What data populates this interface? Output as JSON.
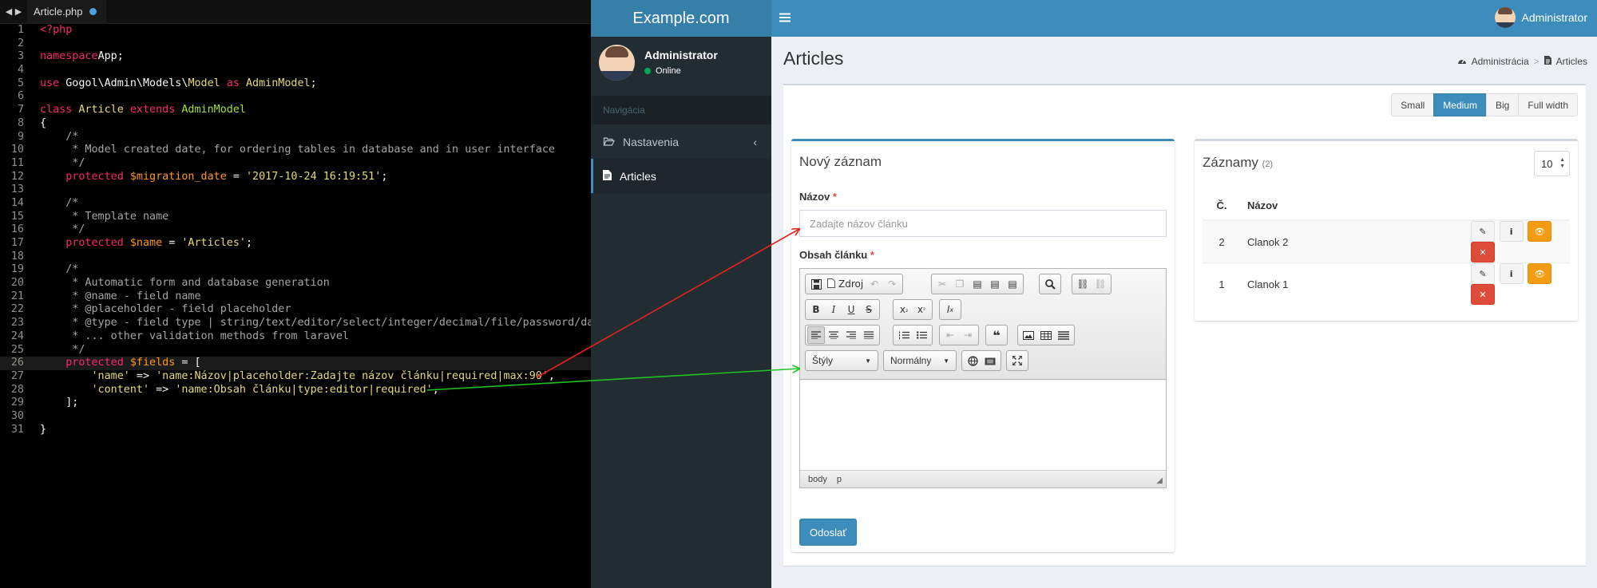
{
  "editor": {
    "tab_filename": "Article.php",
    "nav_arrows": "◀ ▶",
    "lines": [
      {
        "n": "1",
        "t": [
          [
            "k",
            "<?php"
          ]
        ]
      },
      {
        "n": "2",
        "t": []
      },
      {
        "n": "3",
        "t": [
          [
            "k",
            "namespace"
          ],
          [
            "",
            "App;"
          ]
        ]
      },
      {
        "n": "4",
        "t": []
      },
      {
        "n": "5",
        "t": [
          [
            "k",
            "use"
          ],
          [
            "",
            " Gogol\\Admin\\Models\\"
          ],
          [
            "cl",
            "Model"
          ],
          [
            "",
            " "
          ],
          [
            "k",
            "as"
          ],
          [
            "",
            " "
          ],
          [
            "cl",
            "AdminModel"
          ],
          [
            "",
            ";"
          ]
        ]
      },
      {
        "n": "6",
        "t": []
      },
      {
        "n": "7",
        "t": [
          [
            "k",
            "class"
          ],
          [
            "",
            " "
          ],
          [
            "cl",
            "Article"
          ],
          [
            "",
            " "
          ],
          [
            "k",
            "extends"
          ],
          [
            "",
            " "
          ],
          [
            "e",
            "AdminModel"
          ]
        ]
      },
      {
        "n": "8",
        "t": [
          [
            "",
            "{"
          ]
        ]
      },
      {
        "n": "9",
        "t": [
          [
            "c",
            "    /*"
          ]
        ]
      },
      {
        "n": "10",
        "t": [
          [
            "c",
            "     * Model created date, for ordering tables in database and in user interface"
          ]
        ]
      },
      {
        "n": "11",
        "t": [
          [
            "c",
            "     */"
          ]
        ]
      },
      {
        "n": "12",
        "t": [
          [
            "",
            "    "
          ],
          [
            "k",
            "protected"
          ],
          [
            "",
            " "
          ],
          [
            "v",
            "$migration_date"
          ],
          [
            "",
            " = "
          ],
          [
            "s",
            "'2017-10-24 16:19:51'"
          ],
          [
            "",
            ";"
          ]
        ]
      },
      {
        "n": "13",
        "t": []
      },
      {
        "n": "14",
        "t": [
          [
            "c",
            "    /*"
          ]
        ]
      },
      {
        "n": "15",
        "t": [
          [
            "c",
            "     * Template name"
          ]
        ]
      },
      {
        "n": "16",
        "t": [
          [
            "c",
            "     */"
          ]
        ]
      },
      {
        "n": "17",
        "t": [
          [
            "",
            "    "
          ],
          [
            "k",
            "protected"
          ],
          [
            "",
            " "
          ],
          [
            "v",
            "$name"
          ],
          [
            "",
            " = "
          ],
          [
            "s",
            "'Articles'"
          ],
          [
            "",
            ";"
          ]
        ]
      },
      {
        "n": "18",
        "t": []
      },
      {
        "n": "19",
        "t": [
          [
            "c",
            "    /*"
          ]
        ]
      },
      {
        "n": "20",
        "t": [
          [
            "c",
            "     * Automatic form and database generation"
          ]
        ]
      },
      {
        "n": "21",
        "t": [
          [
            "c",
            "     * @name - field name"
          ]
        ]
      },
      {
        "n": "22",
        "t": [
          [
            "c",
            "     * @placeholder - field placeholder"
          ]
        ]
      },
      {
        "n": "23",
        "t": [
          [
            "c",
            "     * @type - field type | string/text/editor/select/integer/decimal/file/password/date"
          ]
        ]
      },
      {
        "n": "24",
        "t": [
          [
            "c",
            "     * ... other validation methods from laravel"
          ]
        ]
      },
      {
        "n": "25",
        "t": [
          [
            "c",
            "     */"
          ]
        ]
      },
      {
        "n": "26",
        "t": [
          [
            "",
            "    "
          ],
          [
            "k",
            "protected"
          ],
          [
            "",
            " "
          ],
          [
            "v",
            "$fields"
          ],
          [
            "",
            " = ["
          ]
        ],
        "hl": true
      },
      {
        "n": "27",
        "t": [
          [
            "",
            "        "
          ],
          [
            "s",
            "'name'"
          ],
          [
            "",
            " => "
          ],
          [
            "s",
            "'name:Názov|placeholder:Zadajte názov článku|required|max:90'"
          ],
          [
            "",
            ","
          ]
        ]
      },
      {
        "n": "28",
        "t": [
          [
            "",
            "        "
          ],
          [
            "s",
            "'content'"
          ],
          [
            "",
            " => "
          ],
          [
            "s",
            "'name:Obsah článku|type:editor|required'"
          ],
          [
            "",
            ","
          ]
        ]
      },
      {
        "n": "29",
        "t": [
          [
            "",
            "    ];"
          ]
        ]
      },
      {
        "n": "30",
        "t": []
      },
      {
        "n": "31",
        "t": [
          [
            "",
            "}"
          ]
        ]
      }
    ]
  },
  "app": {
    "logo": "Example.com",
    "topbar_user": "Administrator",
    "user_panel": {
      "name": "Administrator",
      "status": "Online"
    },
    "nav_header": "Navigácia",
    "nav_items": [
      {
        "label": "Nastavenia",
        "icon": "folder-open-icon",
        "caret": "‹"
      },
      {
        "label": "Articles",
        "icon": "file-icon"
      }
    ],
    "page_title": "Articles",
    "breadcrumb": {
      "home": "Administrácia",
      "separator": ">",
      "current": "Articles"
    },
    "size_buttons": [
      "Small",
      "Medium",
      "Big",
      "Full width"
    ],
    "active_size": "Medium",
    "form": {
      "title": "Nový záznam",
      "name_label": "Názov",
      "name_placeholder": "Zadajte názov článku",
      "required_mark": "*",
      "content_label": "Obsah článku",
      "submit": "Odoslať",
      "editor": {
        "source_label": "Zdroj",
        "styles_combo": "Štýly",
        "format_combo": "Normálny",
        "path": [
          "body",
          "p"
        ]
      }
    },
    "records": {
      "title": "Záznamy",
      "count": "(2)",
      "per_page": "10",
      "columns": [
        "Č.",
        "Názov"
      ],
      "rows": [
        {
          "num": "2",
          "name": "Clanok 2"
        },
        {
          "num": "1",
          "name": "Clanok 1"
        }
      ]
    }
  },
  "colors": {
    "accent": "#3c8dbc",
    "sidebar": "#222d32",
    "arrow_red": "#e32222",
    "arrow_green": "#1fc21f",
    "warning": "#f39c12",
    "danger": "#dd4b39"
  }
}
